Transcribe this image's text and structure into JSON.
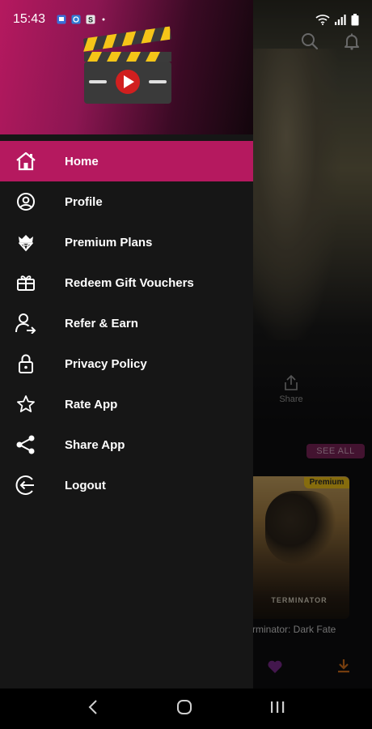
{
  "status_bar": {
    "time": "15:43"
  },
  "drawer": {
    "menu": [
      {
        "label": "Home",
        "icon": "home-icon",
        "active": true
      },
      {
        "label": "Profile",
        "icon": "profile-icon",
        "active": false
      },
      {
        "label": "Premium Plans",
        "icon": "diamond-icon",
        "active": false
      },
      {
        "label": "Redeem Gift Vouchers",
        "icon": "gift-icon",
        "active": false
      },
      {
        "label": "Refer & Earn",
        "icon": "refer-icon",
        "active": false
      },
      {
        "label": "Privacy Policy",
        "icon": "lock-icon",
        "active": false
      },
      {
        "label": "Rate App",
        "icon": "star-icon",
        "active": false
      },
      {
        "label": "Share App",
        "icon": "share-icon",
        "active": false
      },
      {
        "label": "Logout",
        "icon": "logout-icon",
        "active": false
      }
    ]
  },
  "background": {
    "share_label": "Share",
    "see_all_label": "SEE ALL",
    "premium_badge": "Premium",
    "poster_title": "TERMINATOR",
    "movie_title": "rminator: Dark Fate"
  },
  "colors": {
    "accent": "#b5195f",
    "drawer_bg": "#161616",
    "badge": "#f5c518"
  }
}
